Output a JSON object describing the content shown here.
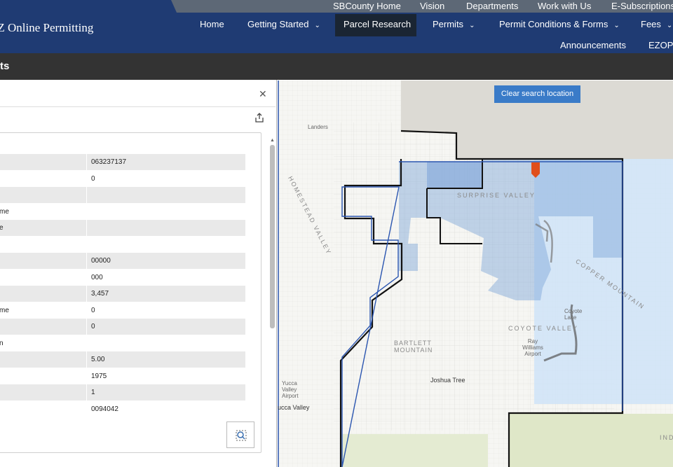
{
  "utility_nav": [
    "SBCounty Home",
    "Vision",
    "Departments",
    "Work with Us",
    "E-Subscriptions"
  ],
  "brand": "EZ Online Permitting",
  "main_nav": {
    "home": "Home",
    "getting_started": "Getting Started",
    "parcel_research": "Parcel Research",
    "permits": "Permits",
    "permit_conditions": "Permit Conditions & Forms",
    "fees": "Fees",
    "announcements": "Announcements",
    "ezop": "EZOP"
  },
  "title_bar": "ts",
  "attributes": [
    {
      "label": "",
      "value": "063237137"
    },
    {
      "label": "",
      "value": "0"
    },
    {
      "label": "",
      "value": ""
    },
    {
      "label": "me",
      "value": ""
    },
    {
      "label": "e",
      "value": ""
    },
    {
      "label": "",
      "value": ""
    },
    {
      "label": "",
      "value": "00000"
    },
    {
      "label": "",
      "value": "000"
    },
    {
      "label": "",
      "value": "3,457"
    },
    {
      "label": "me",
      "value": "0"
    },
    {
      "label": "",
      "value": "0"
    },
    {
      "label": "n",
      "value": ""
    },
    {
      "label": "",
      "value": "5.00"
    },
    {
      "label": "",
      "value": "1975"
    },
    {
      "label": "",
      "value": "1"
    },
    {
      "label": "",
      "value": "0094042"
    }
  ],
  "map": {
    "clear_button": "Clear search location",
    "places": {
      "landers": "Landers",
      "homestead_valley": "HOMESTEAD VALLEY",
      "surprise_valley": "SURPRISE VALLEY",
      "copper_mountain": "COPPER MOUNTAIN",
      "coyote_lake": "Coyote Lake",
      "coyote_valley": "COYOTE VALLEY",
      "ray_williams_airport": "Ray Williams Airport",
      "bartlett_mountain": "BARTLETT MOUNTAIN",
      "joshua_tree": "Joshua Tree",
      "yucca_valley_airport": "Yucca Valley Airport",
      "yucca_valley": "ucca Valley",
      "ind": "IND"
    },
    "colors": {
      "selection_fill": "#7aa3d8",
      "light_blue_zone": "#cfe3f7",
      "boundary_black": "#111111",
      "boundary_blue": "#2a55b0",
      "marker": "#e04e1b",
      "gray_area": "#dcdad4",
      "green_area": "#dfe7c8"
    }
  },
  "icons": {
    "close": "close-icon",
    "share": "share-icon",
    "zoom_to": "zoom-to-icon",
    "location_marker": "location-marker-icon"
  }
}
